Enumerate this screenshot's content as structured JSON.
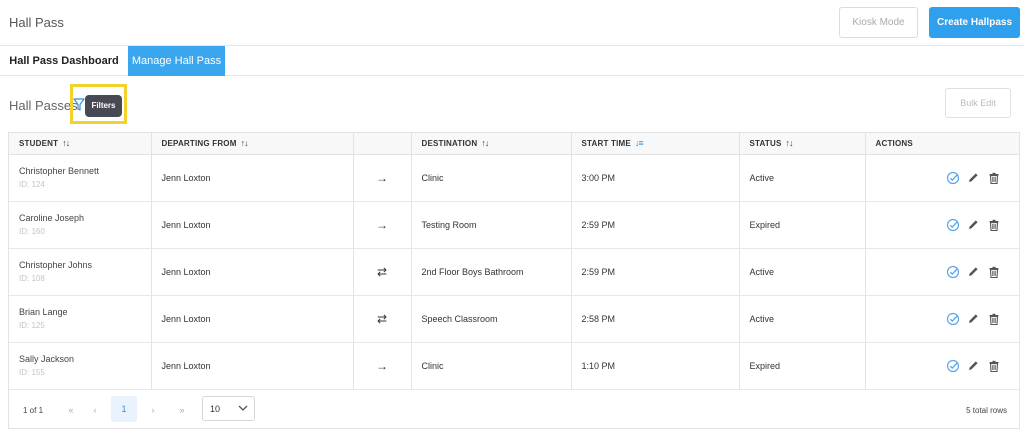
{
  "app": {
    "title": "Hall Pass"
  },
  "header": {
    "kiosk_label": "Kiosk Mode",
    "create_label": "Create Hallpass"
  },
  "tabs": [
    {
      "label": "Hall Pass Dashboard",
      "active": false
    },
    {
      "label": "Manage Hall Pass",
      "active": true
    }
  ],
  "toolbar": {
    "title": "Hall Passes",
    "filters_tooltip": "Filters",
    "bulk_edit_label": "Bulk Edit"
  },
  "table": {
    "columns": {
      "student": "STUDENT",
      "departing": "DEPARTING FROM",
      "destination": "DESTINATION",
      "start_time": "START TIME",
      "status": "STATUS",
      "actions": "ACTIONS"
    },
    "rows": [
      {
        "name": "Christopher Bennett",
        "id": "ID: 124",
        "departing": "Jenn Loxton",
        "direction": "→",
        "destination": "Clinic",
        "start_time": "3:00 PM",
        "status": "Active"
      },
      {
        "name": "Caroline Joseph",
        "id": "ID: 160",
        "departing": "Jenn Loxton",
        "direction": "→",
        "destination": "Testing Room",
        "start_time": "2:59 PM",
        "status": "Expired"
      },
      {
        "name": "Christopher Johns",
        "id": "ID: 108",
        "departing": "Jenn Loxton",
        "direction": "⇄",
        "destination": "2nd Floor Boys Bathroom",
        "start_time": "2:59 PM",
        "status": "Active"
      },
      {
        "name": "Brian Lange",
        "id": "ID: 125",
        "departing": "Jenn Loxton",
        "direction": "⇄",
        "destination": "Speech Classroom",
        "start_time": "2:58 PM",
        "status": "Active"
      },
      {
        "name": "Sally Jackson",
        "id": "ID: 155",
        "departing": "Jenn Loxton",
        "direction": "→",
        "destination": "Clinic",
        "start_time": "1:10 PM",
        "status": "Expired"
      }
    ]
  },
  "pagination": {
    "info": "1 of 1",
    "first": "«",
    "prev": "‹",
    "current_page": "1",
    "next": "›",
    "last": "»",
    "page_size": "10",
    "total": "5 total rows"
  },
  "icons": {
    "filter": "filter-icon",
    "approve": "check-circle-icon",
    "edit": "pencil-icon",
    "delete": "trash-icon",
    "sort": "sort-icon"
  },
  "colors": {
    "primary": "#2fa0ee",
    "highlight": "#f3d22b",
    "tooltip": "#474a52"
  }
}
